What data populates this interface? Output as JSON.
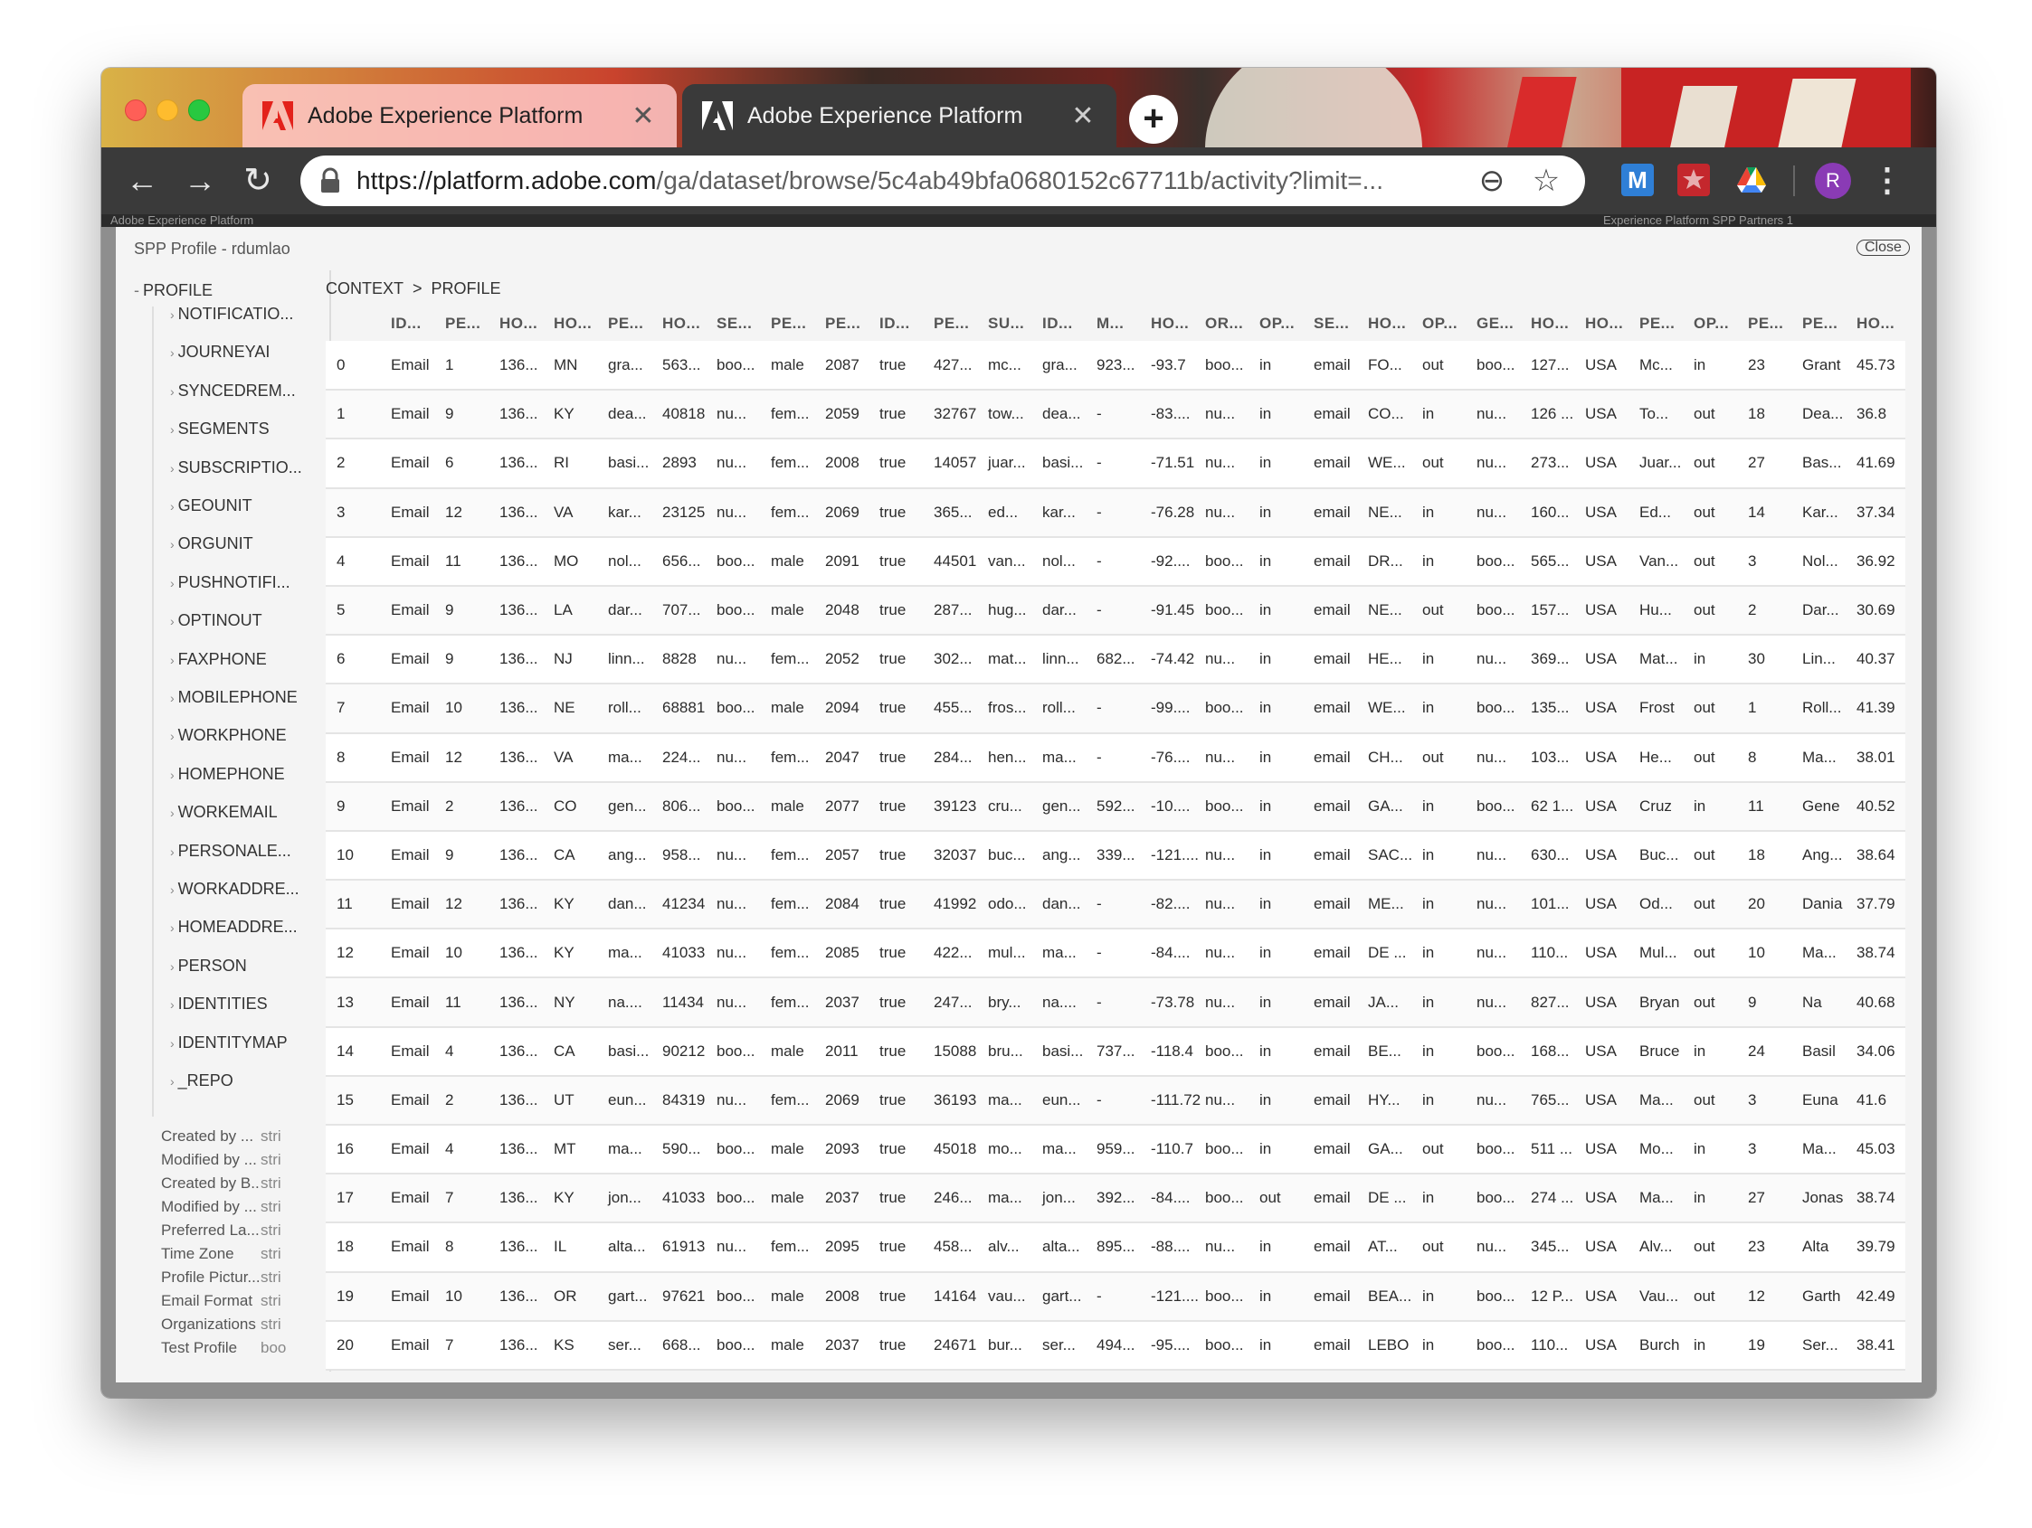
{
  "browser": {
    "tabs": [
      {
        "title": "Adobe Experience Platform",
        "close": "✕"
      },
      {
        "title": "Adobe Experience Platform",
        "close": "✕"
      }
    ],
    "new_tab": "+",
    "url_host": "https://platform.adobe.com",
    "url_path": "/ga/dataset/browse/5c4ab49bfa0680152c67711b/activity?limit=...",
    "avatar_initial": "R",
    "extensions": [
      "M",
      "shield-icon",
      "drive-icon"
    ],
    "nav": {
      "back": "←",
      "forward": "→",
      "reload": "↻",
      "menu": "⋮",
      "zoom": "⊖",
      "star": "☆"
    }
  },
  "app_strip": {
    "left": "Adobe Experience Platform",
    "right": "Experience Platform SPP Partners 1"
  },
  "modal": {
    "title": "SPP Profile - rdumlao",
    "close_label": "Close"
  },
  "sidebar": {
    "root": {
      "caret": "-",
      "label": "PROFILE"
    },
    "items": [
      "NOTIFICATIO...",
      "JOURNEYAI",
      "SYNCEDREM...",
      "SEGMENTS",
      "SUBSCRIPTIO...",
      "GEOUNIT",
      "ORGUNIT",
      "PUSHNOTIFI...",
      "OPTINOUT",
      "FAXPHONE",
      "MOBILEPHONE",
      "WORKPHONE",
      "HOMEPHONE",
      "WORKEMAIL",
      "PERSONALE...",
      "WORKADDRE...",
      "HOMEADDRE...",
      "PERSON",
      "IDENTITIES",
      "IDENTITYMAP",
      "_REPO"
    ],
    "fields": [
      {
        "name": "Created by ...",
        "type": "stri"
      },
      {
        "name": "Modified by ...",
        "type": "stri"
      },
      {
        "name": "Created by B...",
        "type": "stri"
      },
      {
        "name": "Modified by ...",
        "type": "stri"
      },
      {
        "name": "Preferred La...",
        "type": "stri"
      },
      {
        "name": "Time Zone",
        "type": "stri"
      },
      {
        "name": "Profile Pictur...",
        "type": "stri"
      },
      {
        "name": "Email Format",
        "type": "stri"
      },
      {
        "name": "Organizations",
        "type": "stri"
      },
      {
        "name": "Test Profile",
        "type": "boo"
      }
    ]
  },
  "breadcrumb": {
    "first": "CONTEXT",
    "sep": ">",
    "second": "PROFILE"
  },
  "table": {
    "columns": [
      "",
      "ID...",
      "PE...",
      "HO...",
      "HO...",
      "PE...",
      "HO...",
      "SE...",
      "PE...",
      "PE...",
      "ID...",
      "PE...",
      "SU...",
      "ID...",
      "M...",
      "HO...",
      "OR...",
      "OP...",
      "SE...",
      "HO...",
      "OP...",
      "GE...",
      "HO...",
      "HO...",
      "PE...",
      "OP...",
      "PE...",
      "PE...",
      "HO..."
    ],
    "rows": [
      [
        "0",
        "Email",
        "1",
        "136...",
        "MN",
        "gra...",
        "563...",
        "boo...",
        "male",
        "2087",
        "true",
        "427...",
        "mc...",
        "gra...",
        "923...",
        "-93.7",
        "boo...",
        "in",
        "email",
        "FO...",
        "out",
        "boo...",
        "127...",
        "USA",
        "Mc...",
        "in",
        "23",
        "Grant",
        "45.73"
      ],
      [
        "1",
        "Email",
        "9",
        "136...",
        "KY",
        "dea...",
        "40818",
        "nu...",
        "fem...",
        "2059",
        "true",
        "32767",
        "tow...",
        "dea...",
        "-",
        "-83....",
        "nu...",
        "in",
        "email",
        "CO...",
        "in",
        "nu...",
        "126 ...",
        "USA",
        "To...",
        "out",
        "18",
        "Dea...",
        "36.8"
      ],
      [
        "2",
        "Email",
        "6",
        "136...",
        "RI",
        "basi...",
        "2893",
        "nu...",
        "fem...",
        "2008",
        "true",
        "14057",
        "juar...",
        "basi...",
        "-",
        "-71.51",
        "nu...",
        "in",
        "email",
        "WE...",
        "out",
        "nu...",
        "273...",
        "USA",
        "Juar...",
        "out",
        "27",
        "Bas...",
        "41.69"
      ],
      [
        "3",
        "Email",
        "12",
        "136...",
        "VA",
        "kar...",
        "23125",
        "nu...",
        "fem...",
        "2069",
        "true",
        "365...",
        "ed...",
        "kar...",
        "-",
        "-76.28",
        "nu...",
        "in",
        "email",
        "NE...",
        "in",
        "nu...",
        "160...",
        "USA",
        "Ed...",
        "out",
        "14",
        "Kar...",
        "37.34"
      ],
      [
        "4",
        "Email",
        "11",
        "136...",
        "MO",
        "nol...",
        "656...",
        "boo...",
        "male",
        "2091",
        "true",
        "44501",
        "van...",
        "nol...",
        "-",
        "-92....",
        "boo...",
        "in",
        "email",
        "DR...",
        "in",
        "boo...",
        "565...",
        "USA",
        "Van...",
        "out",
        "3",
        "Nol...",
        "36.92"
      ],
      [
        "5",
        "Email",
        "9",
        "136...",
        "LA",
        "dar...",
        "707...",
        "boo...",
        "male",
        "2048",
        "true",
        "287...",
        "hug...",
        "dar...",
        "-",
        "-91.45",
        "boo...",
        "in",
        "email",
        "NE...",
        "out",
        "boo...",
        "157...",
        "USA",
        "Hu...",
        "out",
        "2",
        "Dar...",
        "30.69"
      ],
      [
        "6",
        "Email",
        "9",
        "136...",
        "NJ",
        "linn...",
        "8828",
        "nu...",
        "fem...",
        "2052",
        "true",
        "302...",
        "mat...",
        "linn...",
        "682...",
        "-74.42",
        "nu...",
        "in",
        "email",
        "HE...",
        "in",
        "nu...",
        "369...",
        "USA",
        "Mat...",
        "in",
        "30",
        "Lin...",
        "40.37"
      ],
      [
        "7",
        "Email",
        "10",
        "136...",
        "NE",
        "roll...",
        "68881",
        "boo...",
        "male",
        "2094",
        "true",
        "455...",
        "fros...",
        "roll...",
        "-",
        "-99....",
        "boo...",
        "in",
        "email",
        "WE...",
        "in",
        "boo...",
        "135...",
        "USA",
        "Frost",
        "out",
        "1",
        "Roll...",
        "41.39"
      ],
      [
        "8",
        "Email",
        "12",
        "136...",
        "VA",
        "ma...",
        "224...",
        "nu...",
        "fem...",
        "2047",
        "true",
        "284...",
        "hen...",
        "ma...",
        "-",
        "-76....",
        "nu...",
        "in",
        "email",
        "CH...",
        "out",
        "nu...",
        "103...",
        "USA",
        "He...",
        "out",
        "8",
        "Ma...",
        "38.01"
      ],
      [
        "9",
        "Email",
        "2",
        "136...",
        "CO",
        "gen...",
        "806...",
        "boo...",
        "male",
        "2077",
        "true",
        "39123",
        "cru...",
        "gen...",
        "592...",
        "-10....",
        "boo...",
        "in",
        "email",
        "GA...",
        "in",
        "boo...",
        "62 1...",
        "USA",
        "Cruz",
        "in",
        "11",
        "Gene",
        "40.52"
      ],
      [
        "10",
        "Email",
        "9",
        "136...",
        "CA",
        "ang...",
        "958...",
        "nu...",
        "fem...",
        "2057",
        "true",
        "32037",
        "buc...",
        "ang...",
        "339...",
        "-121....",
        "nu...",
        "in",
        "email",
        "SAC...",
        "in",
        "nu...",
        "630...",
        "USA",
        "Buc...",
        "out",
        "18",
        "Ang...",
        "38.64"
      ],
      [
        "11",
        "Email",
        "12",
        "136...",
        "KY",
        "dan...",
        "41234",
        "nu...",
        "fem...",
        "2084",
        "true",
        "41992",
        "odo...",
        "dan...",
        "-",
        "-82....",
        "nu...",
        "in",
        "email",
        "ME...",
        "in",
        "nu...",
        "101...",
        "USA",
        "Od...",
        "out",
        "20",
        "Dania",
        "37.79"
      ],
      [
        "12",
        "Email",
        "10",
        "136...",
        "KY",
        "ma...",
        "41033",
        "nu...",
        "fem...",
        "2085",
        "true",
        "422...",
        "mul...",
        "ma...",
        "-",
        "-84....",
        "nu...",
        "in",
        "email",
        "DE ...",
        "in",
        "nu...",
        "110...",
        "USA",
        "Mul...",
        "out",
        "10",
        "Ma...",
        "38.74"
      ],
      [
        "13",
        "Email",
        "11",
        "136...",
        "NY",
        "na....",
        "11434",
        "nu...",
        "fem...",
        "2037",
        "true",
        "247...",
        "bry...",
        "na....",
        "-",
        "-73.78",
        "nu...",
        "in",
        "email",
        "JA...",
        "in",
        "nu...",
        "827...",
        "USA",
        "Bryan",
        "out",
        "9",
        "Na",
        "40.68"
      ],
      [
        "14",
        "Email",
        "4",
        "136...",
        "CA",
        "basi...",
        "90212",
        "boo...",
        "male",
        "2011",
        "true",
        "15088",
        "bru...",
        "basi...",
        "737...",
        "-118.4",
        "boo...",
        "in",
        "email",
        "BE...",
        "in",
        "boo...",
        "168...",
        "USA",
        "Bruce",
        "in",
        "24",
        "Basil",
        "34.06"
      ],
      [
        "15",
        "Email",
        "2",
        "136...",
        "UT",
        "eun...",
        "84319",
        "nu...",
        "fem...",
        "2069",
        "true",
        "36193",
        "ma...",
        "eun...",
        "-",
        "-111.72",
        "nu...",
        "in",
        "email",
        "HY...",
        "in",
        "nu...",
        "765...",
        "USA",
        "Ma...",
        "out",
        "3",
        "Euna",
        "41.6"
      ],
      [
        "16",
        "Email",
        "4",
        "136...",
        "MT",
        "ma...",
        "590...",
        "boo...",
        "male",
        "2093",
        "true",
        "45018",
        "mo...",
        "ma...",
        "959...",
        "-110.7",
        "boo...",
        "in",
        "email",
        "GA...",
        "out",
        "boo...",
        "511 ...",
        "USA",
        "Mo...",
        "in",
        "3",
        "Ma...",
        "45.03"
      ],
      [
        "17",
        "Email",
        "7",
        "136...",
        "KY",
        "jon...",
        "41033",
        "boo...",
        "male",
        "2037",
        "true",
        "246...",
        "ma...",
        "jon...",
        "392...",
        "-84....",
        "boo...",
        "out",
        "email",
        "DE ...",
        "in",
        "boo...",
        "274 ...",
        "USA",
        "Ma...",
        "in",
        "27",
        "Jonas",
        "38.74"
      ],
      [
        "18",
        "Email",
        "8",
        "136...",
        "IL",
        "alta...",
        "61913",
        "nu...",
        "fem...",
        "2095",
        "true",
        "458...",
        "alv...",
        "alta...",
        "895...",
        "-88....",
        "nu...",
        "in",
        "email",
        "AT...",
        "out",
        "nu...",
        "345...",
        "USA",
        "Alv...",
        "out",
        "23",
        "Alta",
        "39.79"
      ],
      [
        "19",
        "Email",
        "10",
        "136...",
        "OR",
        "gart...",
        "97621",
        "boo...",
        "male",
        "2008",
        "true",
        "14164",
        "vau...",
        "gart...",
        "-",
        "-121....",
        "boo...",
        "in",
        "email",
        "BEA...",
        "in",
        "boo...",
        "12 P...",
        "USA",
        "Vau...",
        "out",
        "12",
        "Garth",
        "42.49"
      ],
      [
        "20",
        "Email",
        "7",
        "136...",
        "KS",
        "ser...",
        "668...",
        "boo...",
        "male",
        "2037",
        "true",
        "24671",
        "bur...",
        "ser...",
        "494...",
        "-95....",
        "boo...",
        "in",
        "email",
        "LEBO",
        "in",
        "boo...",
        "110...",
        "USA",
        "Burch",
        "in",
        "19",
        "Ser...",
        "38.41"
      ]
    ]
  },
  "colors": {
    "tab_active_bg": "#3a3a3a",
    "avatar": "#8a3bb5",
    "traffic_red": "#fe5f57",
    "traffic_yellow": "#febc2e",
    "traffic_green": "#28c840"
  }
}
